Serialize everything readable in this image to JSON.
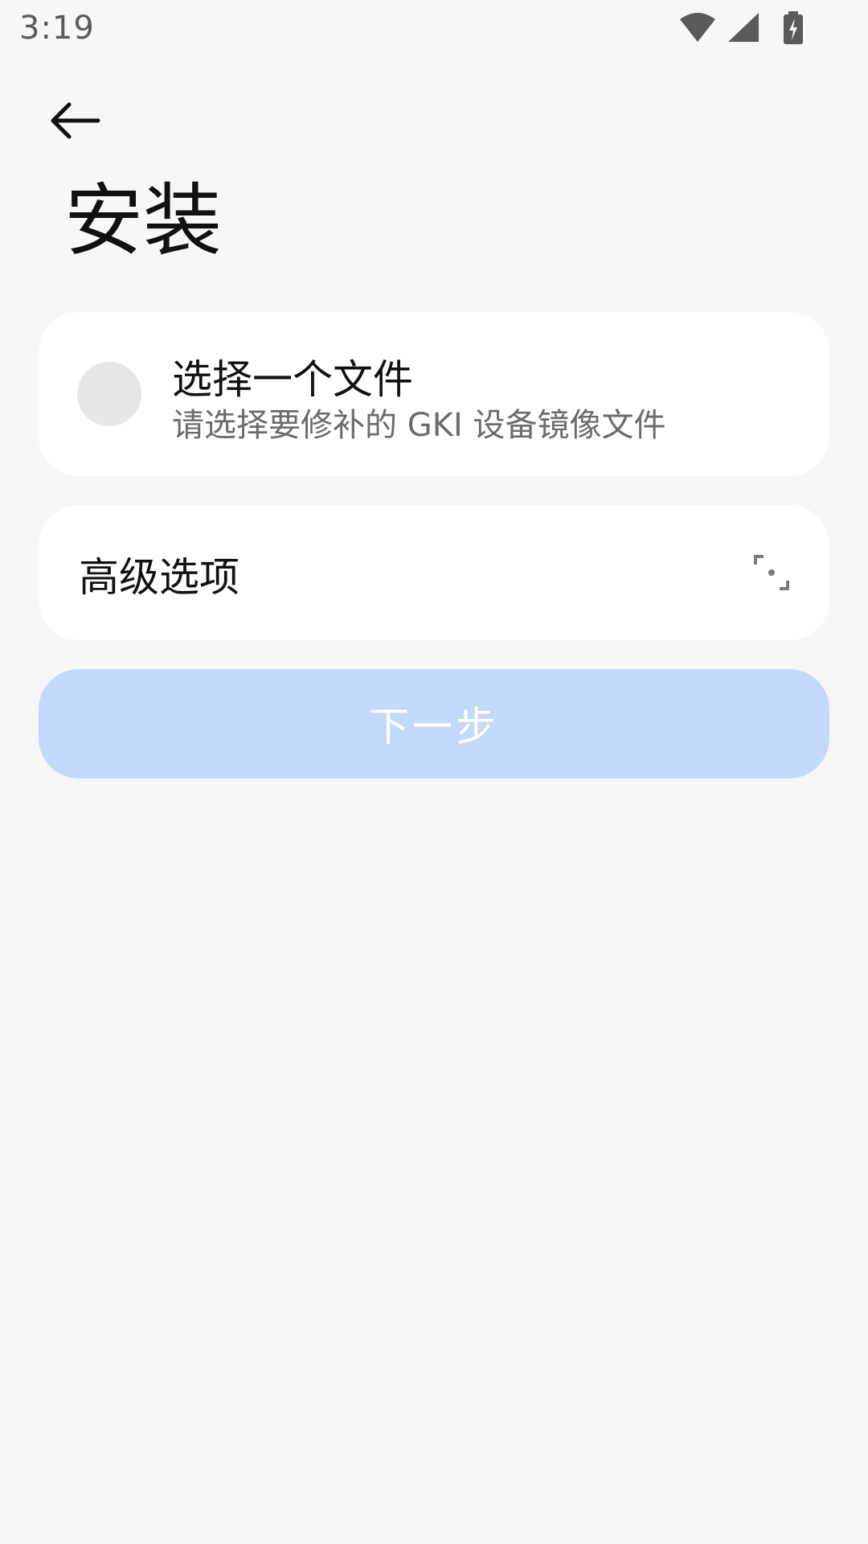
{
  "status_bar": {
    "time": "3:19",
    "icons": [
      "wifi-icon",
      "signal-icon",
      "battery-charging-icon"
    ]
  },
  "header": {
    "back_icon": "arrow-left-icon",
    "title": "安装"
  },
  "file_card": {
    "title": "选择一个文件",
    "subtitle": "请选择要修补的 GKI 设备镜像文件",
    "selected": false
  },
  "advanced_card": {
    "label": "高级选项",
    "icon": "expand-icon"
  },
  "next_button": {
    "label": "下一步",
    "enabled": false
  },
  "colors": {
    "background": "#f7f7f7",
    "card": "#ffffff",
    "button_disabled": "#c3d9fb",
    "radio": "#e6e6e6"
  }
}
